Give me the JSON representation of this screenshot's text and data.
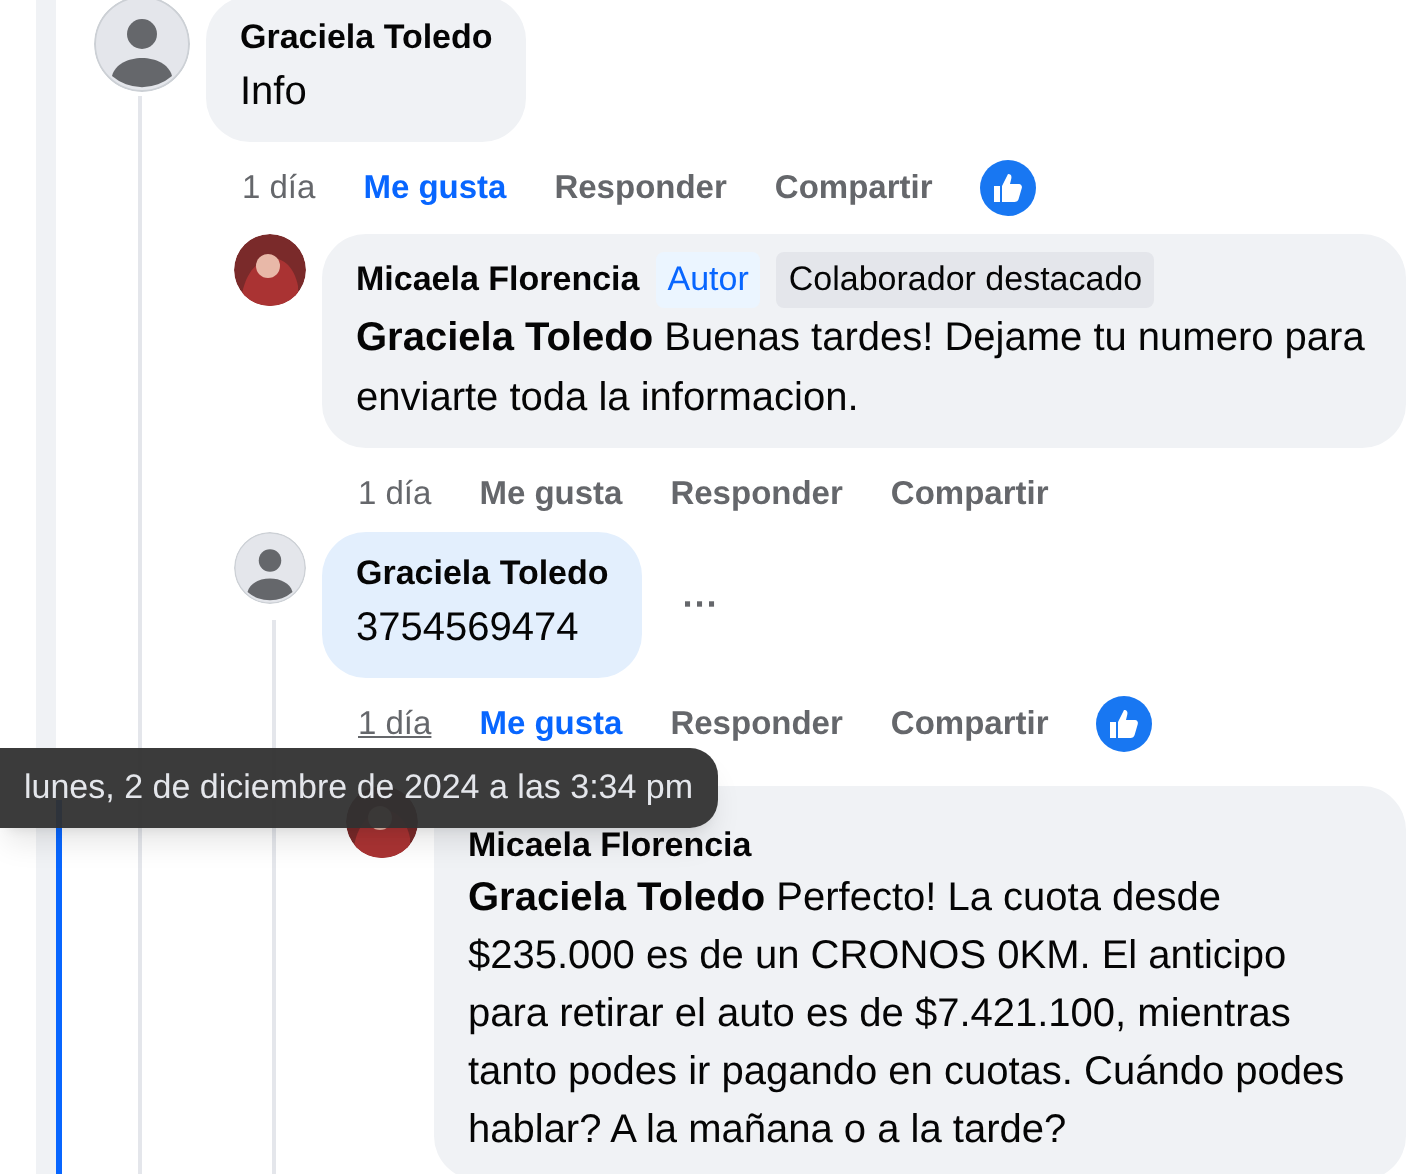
{
  "comments": [
    {
      "author": "Graciela Toledo",
      "text": "Info",
      "avatar": {
        "kind": "generic"
      },
      "highlighted": false,
      "actions": {
        "time": "1 día",
        "time_hovered": false,
        "like": "Me gusta",
        "liked": true,
        "reply": "Responder",
        "share": "Compartir",
        "reaction": true
      },
      "children": [
        {
          "author": "Micaela Florencia",
          "text": "**Graciela Toledo** Buenas tardes! Dejame tu numero para enviarte toda la informacion.",
          "avatar": {
            "kind": "photo"
          },
          "highlighted": false,
          "badges": [
            {
              "label": "Autor",
              "kind": "author"
            },
            {
              "label": "Colaborador destacado",
              "kind": "contributor"
            }
          ],
          "actions": {
            "time": "1 día",
            "time_hovered": false,
            "like": "Me gusta",
            "liked": false,
            "reply": "Responder",
            "share": "Compartir"
          }
        },
        {
          "author": "Graciela Toledo",
          "text": "3754569474",
          "avatar": {
            "kind": "generic"
          },
          "highlighted": true,
          "more_menu": "···",
          "actions": {
            "time": "1 día",
            "time_hovered": true,
            "like": "Me gusta",
            "liked": true,
            "reply": "Responder",
            "share": "Compartir",
            "reaction": true
          },
          "children": [
            {
              "author": "Micaela Florencia",
              "text": "**Graciela Toledo** Perfecto! La cuota desde $235.000 es de un CRONOS 0KM. El anticipo para retirar el auto es de $7.421.100, mientras tanto podes ir pagando en cuotas. Cuándo podes hablar? A la mañana o a la tarde?",
              "avatar": {
                "kind": "photo"
              },
              "highlighted": false
            }
          ]
        }
      ]
    }
  ],
  "tooltip": "lunes, 2 de diciembre de 2024 a las 3:34 pm"
}
